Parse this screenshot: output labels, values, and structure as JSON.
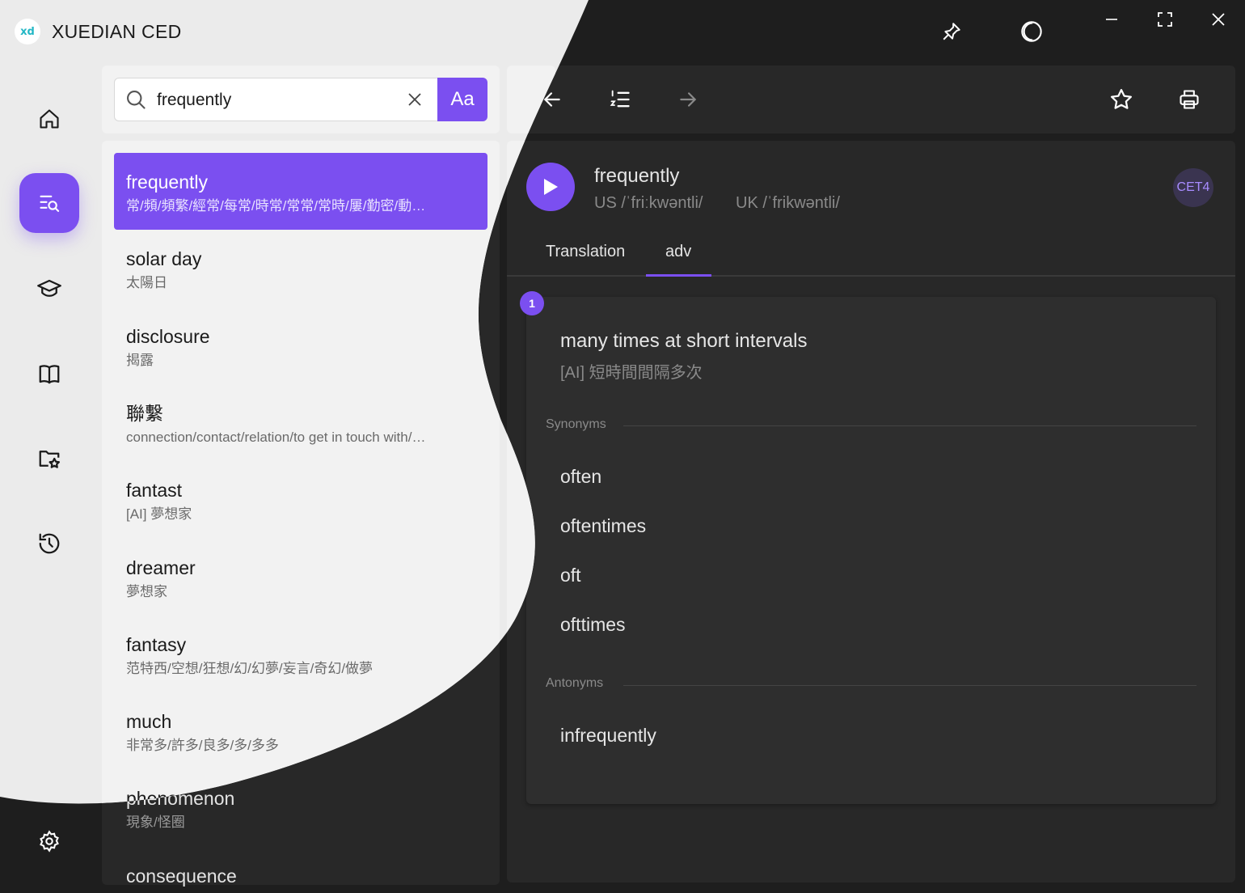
{
  "app": {
    "logo_text": "xd",
    "title": "XUEDIAN CED"
  },
  "window_controls": [
    "pin-icon",
    "theme-toggle-icon",
    "minimize-icon",
    "fullscreen-icon",
    "close-icon"
  ],
  "nav_rail": {
    "items": [
      {
        "name": "home",
        "icon": "home-icon",
        "active": false
      },
      {
        "name": "dictionary",
        "icon": "dictionary-search-icon",
        "active": true
      },
      {
        "name": "learn",
        "icon": "graduation-cap-icon",
        "active": false
      },
      {
        "name": "wordbook",
        "icon": "book-icon",
        "active": false
      },
      {
        "name": "favorites",
        "icon": "folder-star-icon",
        "active": false
      },
      {
        "name": "history",
        "icon": "history-icon",
        "active": false
      }
    ],
    "settings_icon": "gear-icon"
  },
  "search": {
    "value": "frequently",
    "clear_icon": "close-icon",
    "mode_label": "Aa"
  },
  "results": [
    {
      "word": "frequently",
      "definition": "常/頻/頻繁/經常/每常/時常/常常/常時/屢/勤密/動…",
      "selected": true
    },
    {
      "word": "solar day",
      "definition": "太陽日"
    },
    {
      "word": "disclosure",
      "definition": "揭露"
    },
    {
      "word": "聯繫",
      "definition": "connection/contact/relation/to get in touch with/…"
    },
    {
      "word": "fantast",
      "definition": "[AI] 夢想家"
    },
    {
      "word": "dreamer",
      "definition": "夢想家"
    },
    {
      "word": "fantasy",
      "definition": "范特西/空想/狂想/幻/幻夢/妄言/奇幻/做夢"
    },
    {
      "word": "much",
      "definition": "非常多/許多/良多/多/多多"
    },
    {
      "word": "phenomenon",
      "definition": "現象/怪圈"
    },
    {
      "word": "consequence",
      "definition": ""
    }
  ],
  "toolbar": [
    "back-arrow-icon",
    "ordered-list-icon",
    "forward-arrow-icon",
    "star-icon",
    "printer-icon"
  ],
  "entry": {
    "word": "frequently",
    "us_pron": "US /ˈfriːkwəntli/",
    "uk_pron": "UK /ˈfrikwəntli/",
    "level": "CET4",
    "tabs": [
      "Translation",
      "adv"
    ],
    "active_tab": "adv",
    "sense": {
      "number": "1",
      "definition": "many times at short intervals",
      "translation": "[AI] 短時間間隔多次",
      "synonyms_label": "Synonyms",
      "synonyms": [
        "often",
        "oftentimes",
        "oft",
        "ofttimes"
      ],
      "antonyms_label": "Antonyms",
      "antonyms": [
        "infrequently"
      ]
    }
  },
  "colors": {
    "accent": "#7b4ff0",
    "dark_bg": "#1e1e1e",
    "light_bg": "#ebebeb"
  }
}
